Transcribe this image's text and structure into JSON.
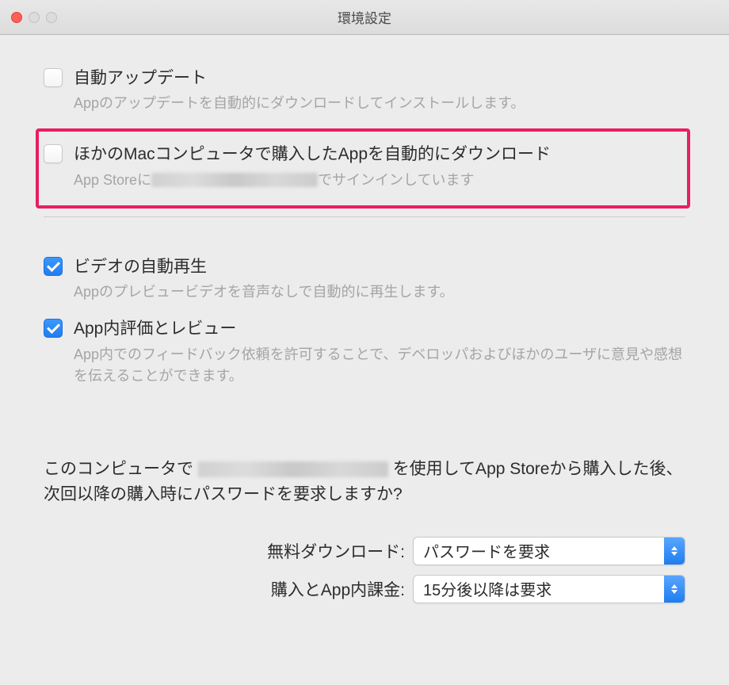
{
  "window": {
    "title": "環境設定"
  },
  "prefs": {
    "auto_update": {
      "label": "自動アップデート",
      "desc": "Appのアップデートを自動的にダウンロードしてインストールします。",
      "checked": false
    },
    "auto_download": {
      "label": "ほかのMacコンピュータで購入したAppを自動的にダウンロード",
      "desc_prefix": "App Storeに",
      "desc_suffix": "でサインインしています",
      "checked": false
    },
    "video_autoplay": {
      "label": "ビデオの自動再生",
      "desc": "Appのプレビュービデオを音声なしで自動的に再生します。",
      "checked": true
    },
    "in_app_review": {
      "label": "App内評価とレビュー",
      "desc": "App内でのフィードバック依頼を許可することで、デベロッパおよびほかのユーザに意見や感想を伝えることができます。",
      "checked": true
    }
  },
  "purchase": {
    "text_prefix": "このコンピュータで",
    "text_suffix": "を使用してApp Storeから購入した後、次回以降の購入時にパスワードを要求しますか?",
    "free_label": "無料ダウンロード:",
    "free_value": "パスワードを要求",
    "paid_label": "購入とApp内課金:",
    "paid_value": "15分後以降は要求"
  }
}
